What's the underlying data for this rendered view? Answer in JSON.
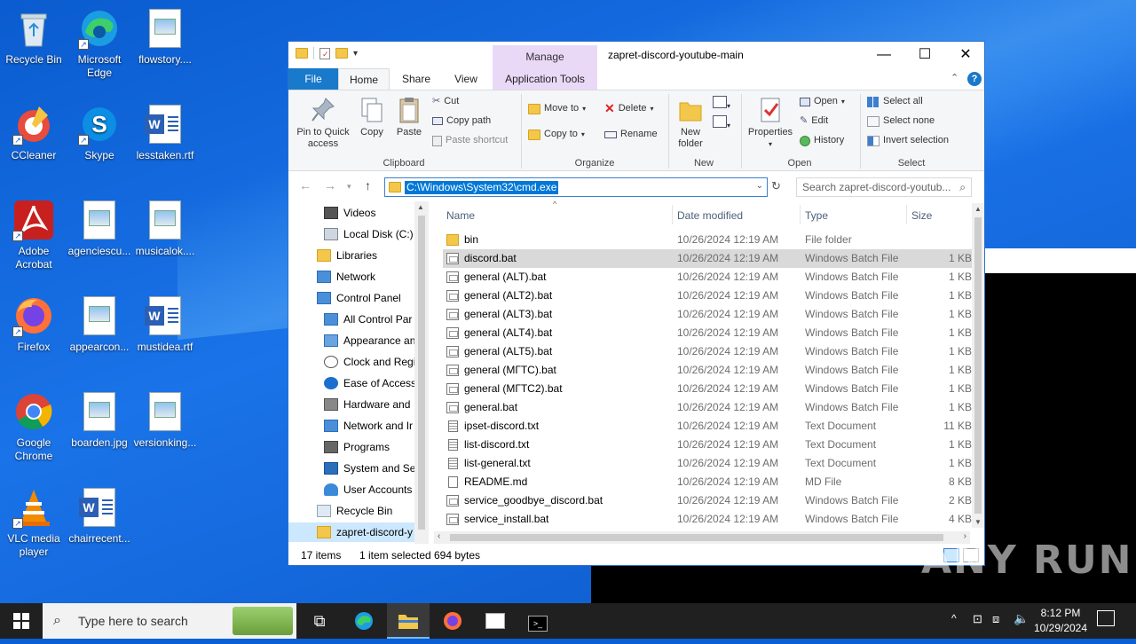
{
  "desktop": {
    "icons": [
      {
        "label": "Recycle Bin"
      },
      {
        "label": "Microsoft Edge"
      },
      {
        "label": "flowstory...."
      },
      {
        "label": "CCleaner"
      },
      {
        "label": "Skype"
      },
      {
        "label": "lesstaken.rtf"
      },
      {
        "label": "Adobe Acrobat"
      },
      {
        "label": "agenciescu..."
      },
      {
        "label": "musicalok...."
      },
      {
        "label": "Firefox"
      },
      {
        "label": "appearcon..."
      },
      {
        "label": "mustidea.rtf"
      },
      {
        "label": "Google Chrome"
      },
      {
        "label": "boarden.jpg"
      },
      {
        "label": "versionking..."
      },
      {
        "label": "VLC media player"
      },
      {
        "label": "chairrecent..."
      }
    ]
  },
  "window": {
    "title": "zapret-discord-youtube-main",
    "manage_tab": "Manage",
    "tabs": {
      "file": "File",
      "home": "Home",
      "share": "Share",
      "view": "View",
      "app_tools": "Application Tools"
    },
    "ribbon": {
      "pin": "Pin to Quick access",
      "copy": "Copy",
      "paste": "Paste",
      "cut": "Cut",
      "copy_path": "Copy path",
      "paste_shortcut": "Paste shortcut",
      "clipboard": "Clipboard",
      "move_to": "Move to",
      "copy_to": "Copy to",
      "delete": "Delete",
      "rename": "Rename",
      "organize": "Organize",
      "new_folder": "New folder",
      "new": "New",
      "properties": "Properties",
      "open_btn": "Open",
      "edit": "Edit",
      "history": "History",
      "open_group": "Open",
      "select_all": "Select all",
      "select_none": "Select none",
      "invert_selection": "Invert selection",
      "select_group": "Select"
    },
    "address": "C:\\Windows\\System32\\cmd.exe",
    "search_placeholder": "Search zapret-discord-youtub...",
    "nav": [
      {
        "label": "Videos"
      },
      {
        "label": "Local Disk (C:)"
      },
      {
        "label": "Libraries"
      },
      {
        "label": "Network"
      },
      {
        "label": "Control Panel"
      },
      {
        "label": "All Control Par"
      },
      {
        "label": "Appearance an"
      },
      {
        "label": "Clock and Regi"
      },
      {
        "label": "Ease of Access"
      },
      {
        "label": "Hardware and"
      },
      {
        "label": "Network and Ir"
      },
      {
        "label": "Programs"
      },
      {
        "label": "System and Sec"
      },
      {
        "label": "User Accounts"
      },
      {
        "label": "Recycle Bin"
      },
      {
        "label": "zapret-discord-y"
      }
    ],
    "columns": {
      "name": "Name",
      "date": "Date modified",
      "type": "Type",
      "size": "Size"
    },
    "files": [
      {
        "name": "bin",
        "date": "10/26/2024 12:19 AM",
        "type": "File folder",
        "size": ""
      },
      {
        "name": "discord.bat",
        "date": "10/26/2024 12:19 AM",
        "type": "Windows Batch File",
        "size": "1 KB"
      },
      {
        "name": "general (ALT).bat",
        "date": "10/26/2024 12:19 AM",
        "type": "Windows Batch File",
        "size": "1 KB"
      },
      {
        "name": "general (ALT2).bat",
        "date": "10/26/2024 12:19 AM",
        "type": "Windows Batch File",
        "size": "1 KB"
      },
      {
        "name": "general (ALT3).bat",
        "date": "10/26/2024 12:19 AM",
        "type": "Windows Batch File",
        "size": "1 KB"
      },
      {
        "name": "general (ALT4).bat",
        "date": "10/26/2024 12:19 AM",
        "type": "Windows Batch File",
        "size": "1 KB"
      },
      {
        "name": "general (ALT5).bat",
        "date": "10/26/2024 12:19 AM",
        "type": "Windows Batch File",
        "size": "1 KB"
      },
      {
        "name": "general (МГТС).bat",
        "date": "10/26/2024 12:19 AM",
        "type": "Windows Batch File",
        "size": "1 KB"
      },
      {
        "name": "general (МГТС2).bat",
        "date": "10/26/2024 12:19 AM",
        "type": "Windows Batch File",
        "size": "1 KB"
      },
      {
        "name": "general.bat",
        "date": "10/26/2024 12:19 AM",
        "type": "Windows Batch File",
        "size": "1 KB"
      },
      {
        "name": "ipset-discord.txt",
        "date": "10/26/2024 12:19 AM",
        "type": "Text Document",
        "size": "11 KB"
      },
      {
        "name": "list-discord.txt",
        "date": "10/26/2024 12:19 AM",
        "type": "Text Document",
        "size": "1 KB"
      },
      {
        "name": "list-general.txt",
        "date": "10/26/2024 12:19 AM",
        "type": "Text Document",
        "size": "1 KB"
      },
      {
        "name": "README.md",
        "date": "10/26/2024 12:19 AM",
        "type": "MD File",
        "size": "8 KB"
      },
      {
        "name": "service_goodbye_discord.bat",
        "date": "10/26/2024 12:19 AM",
        "type": "Windows Batch File",
        "size": "2 KB"
      },
      {
        "name": "service_install.bat",
        "date": "10/26/2024 12:19 AM",
        "type": "Windows Batch File",
        "size": "4 KB"
      }
    ],
    "status": {
      "count": "17 items",
      "selected": "1 item selected",
      "bytes": "694 bytes"
    }
  },
  "taskbar": {
    "search_placeholder": "Type here to search",
    "time": "8:12 PM",
    "date": "10/29/2024"
  },
  "watermark": "ANY RUN",
  "colors": {
    "accent": "#1979ca",
    "manage_tab": "#e9d9f7",
    "selection": "#0078d7",
    "taskbar": "#202020"
  }
}
